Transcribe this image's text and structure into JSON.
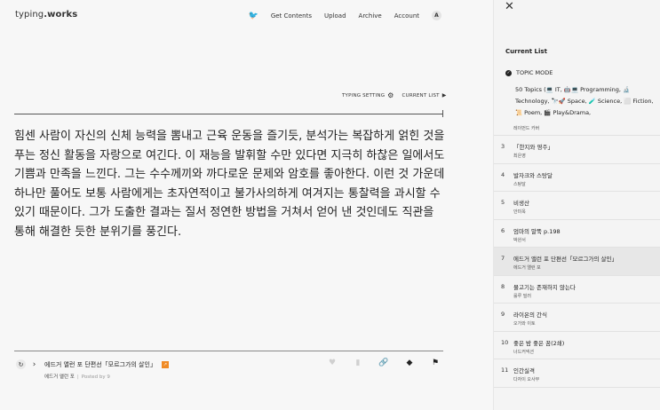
{
  "header": {
    "logo_light": "typing",
    "logo_bold": ".works",
    "nav": [
      "Get Contents",
      "Upload",
      "Archive",
      "Account"
    ],
    "avatar": "A",
    "bird_icon": "bird-icon"
  },
  "settings": {
    "typing_setting": "TYPING SETTING",
    "current_list": "CURRENT LIST"
  },
  "passage": {
    "text": "힘센 사람이 자신의 신체 능력을 뽐내고 근육 운동을 즐기듯, 분석가는 복잡하게 얽힌 것을 푸는 정신 활동을 자랑으로 여긴다. 이 재능을 발휘할 수만 있다면 지극히 하찮은 일에서도 기쁨과 만족을 느낀다. 그는 수수께끼와 까다로운 문제와 암호를 좋아한다. 이런 것 가운데 하나만 풀어도 보통 사람에게는 초자연적이고 불가사의하게 여겨지는 통찰력을 과시할 수 있기 때문이다. 그가 도출한 결과는 질서 정연한 방법을 거쳐서 얻어 낸 것인데도 직관을 통해 해결한 듯한 분위기를 풍긴다."
  },
  "footer": {
    "work_title": "에드거 앨런 포 단편선「모르그가의 살인」",
    "author": "에드거 앨런 포",
    "posted_by": "Posted by 9",
    "badge_color": "#f08a24"
  },
  "panel": {
    "title": "Current List",
    "topic_mode": "TOPIC MODE",
    "topics": "50 Topics (💻 IT, 🤖💻 Programming, 🔬 Technology, 🔭🚀 Space, 🧪 Science, ⬜ Fiction, 📜 Poem, 🎬 Play&Drama,",
    "items": [
      {
        "num": "",
        "title": "",
        "author": "레이먼드 카버"
      },
      {
        "num": "3",
        "title": "「한지와 영주」",
        "author": "최은영"
      },
      {
        "num": "4",
        "title": "발자크와 스탕달",
        "author": "스탕달"
      },
      {
        "num": "5",
        "title": "비생산",
        "author": "안미옥"
      },
      {
        "num": "6",
        "title": "엄마의 말뚝 p.198",
        "author": "박완서"
      },
      {
        "num": "7",
        "title": "에드거 앨런 포 단편선「모르그가의 살인」",
        "author": "에드거 앨런 포"
      },
      {
        "num": "8",
        "title": "물고기는 존재하지 않는다",
        "author": "룰루 밀러"
      },
      {
        "num": "9",
        "title": "라이온의 간식",
        "author": "오가와 이토"
      },
      {
        "num": "10",
        "title": "좋은 밤 좋은 꿈(2쇄)",
        "author": "너드커넥션"
      },
      {
        "num": "11",
        "title": "인간실격",
        "author": "다자이 오사무"
      }
    ],
    "active_index": 5
  }
}
